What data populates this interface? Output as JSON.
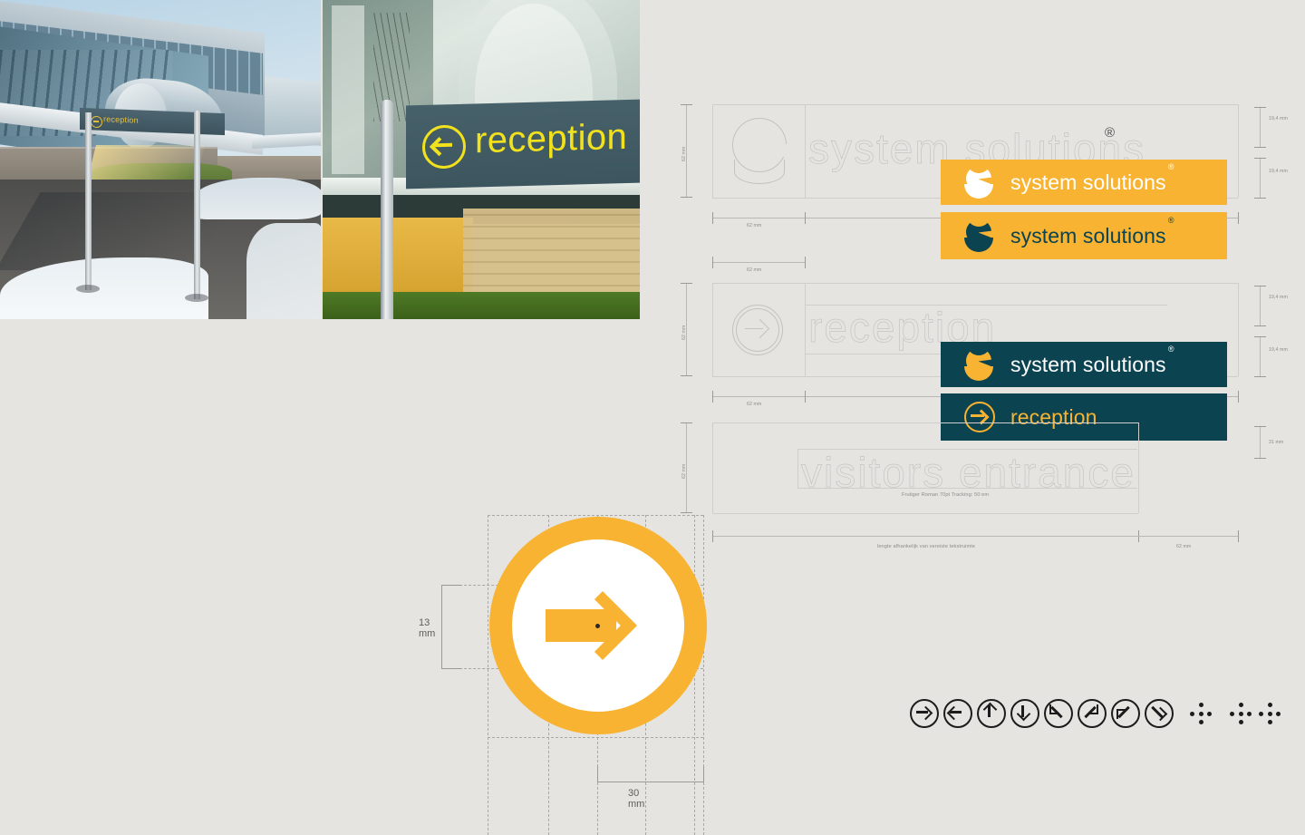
{
  "brand": {
    "name": "system solutions",
    "registered": "®",
    "colors": {
      "amber": "#F7B331",
      "teal": "#0B4351",
      "page_bg": "#E5E4E1",
      "line": "#b9b8b4"
    }
  },
  "photos": [
    {
      "name": "building-exterior-with-reception-sign",
      "sign_text": "reception"
    },
    {
      "name": "reception-sign-closeup",
      "sign_text": "reception"
    }
  ],
  "spec_blocks": [
    {
      "id": "system-solutions",
      "outline_text": "system solutions",
      "registered": "®",
      "height_label": "62 mm",
      "width_label": "62 mm",
      "right_dims": [
        "19,4 mm",
        "19,4 mm"
      ],
      "bars": [
        {
          "variant": "amber",
          "label": "system solutions",
          "registered": "®"
        },
        {
          "variant": "amber-dark-mark",
          "label": "system solutions",
          "registered": "®"
        }
      ]
    },
    {
      "id": "reception",
      "outline_text": "reception",
      "height_label": "62 mm",
      "width_label": "62 mm",
      "right_dims": [
        "19,4 mm",
        "19,4 mm"
      ],
      "bars": [
        {
          "variant": "teal",
          "label": "system solutions",
          "registered": "®"
        },
        {
          "variant": "teal-arrow",
          "label": "reception",
          "registered": ""
        }
      ]
    },
    {
      "id": "visitors-entrance",
      "outline_text": "visitors entrance",
      "height_label": "62 mm",
      "width_label": "62 mm",
      "right_dims": [
        "31 mm"
      ],
      "type_spec": "Frutiger Roman 70pt Tracking: 50 em",
      "note": "lengte afhankelijk van vereiste tekstruimte"
    }
  ],
  "arrow_construction": {
    "title": "arrow-pictogram-construction",
    "height_label": "13 mm",
    "width_label": "30 mm"
  },
  "pictograms": {
    "arrows": [
      {
        "name": "arrow-right-icon",
        "direction": "right"
      },
      {
        "name": "arrow-left-icon",
        "direction": "left"
      },
      {
        "name": "arrow-up-icon",
        "direction": "up"
      },
      {
        "name": "arrow-down-icon",
        "direction": "down"
      },
      {
        "name": "arrow-up-left-icon",
        "direction": "up-left"
      },
      {
        "name": "arrow-up-right-icon",
        "direction": "up-right"
      },
      {
        "name": "arrow-down-left-icon",
        "direction": "down-left"
      },
      {
        "name": "arrow-down-right-icon",
        "direction": "down-right"
      }
    ],
    "dot_groups": [
      {
        "name": "dot-cluster-icon",
        "dots": 5
      },
      {
        "name": "dot-cluster-icon",
        "dots": 5
      },
      {
        "name": "dot-cluster-icon",
        "dots": 5
      }
    ]
  }
}
